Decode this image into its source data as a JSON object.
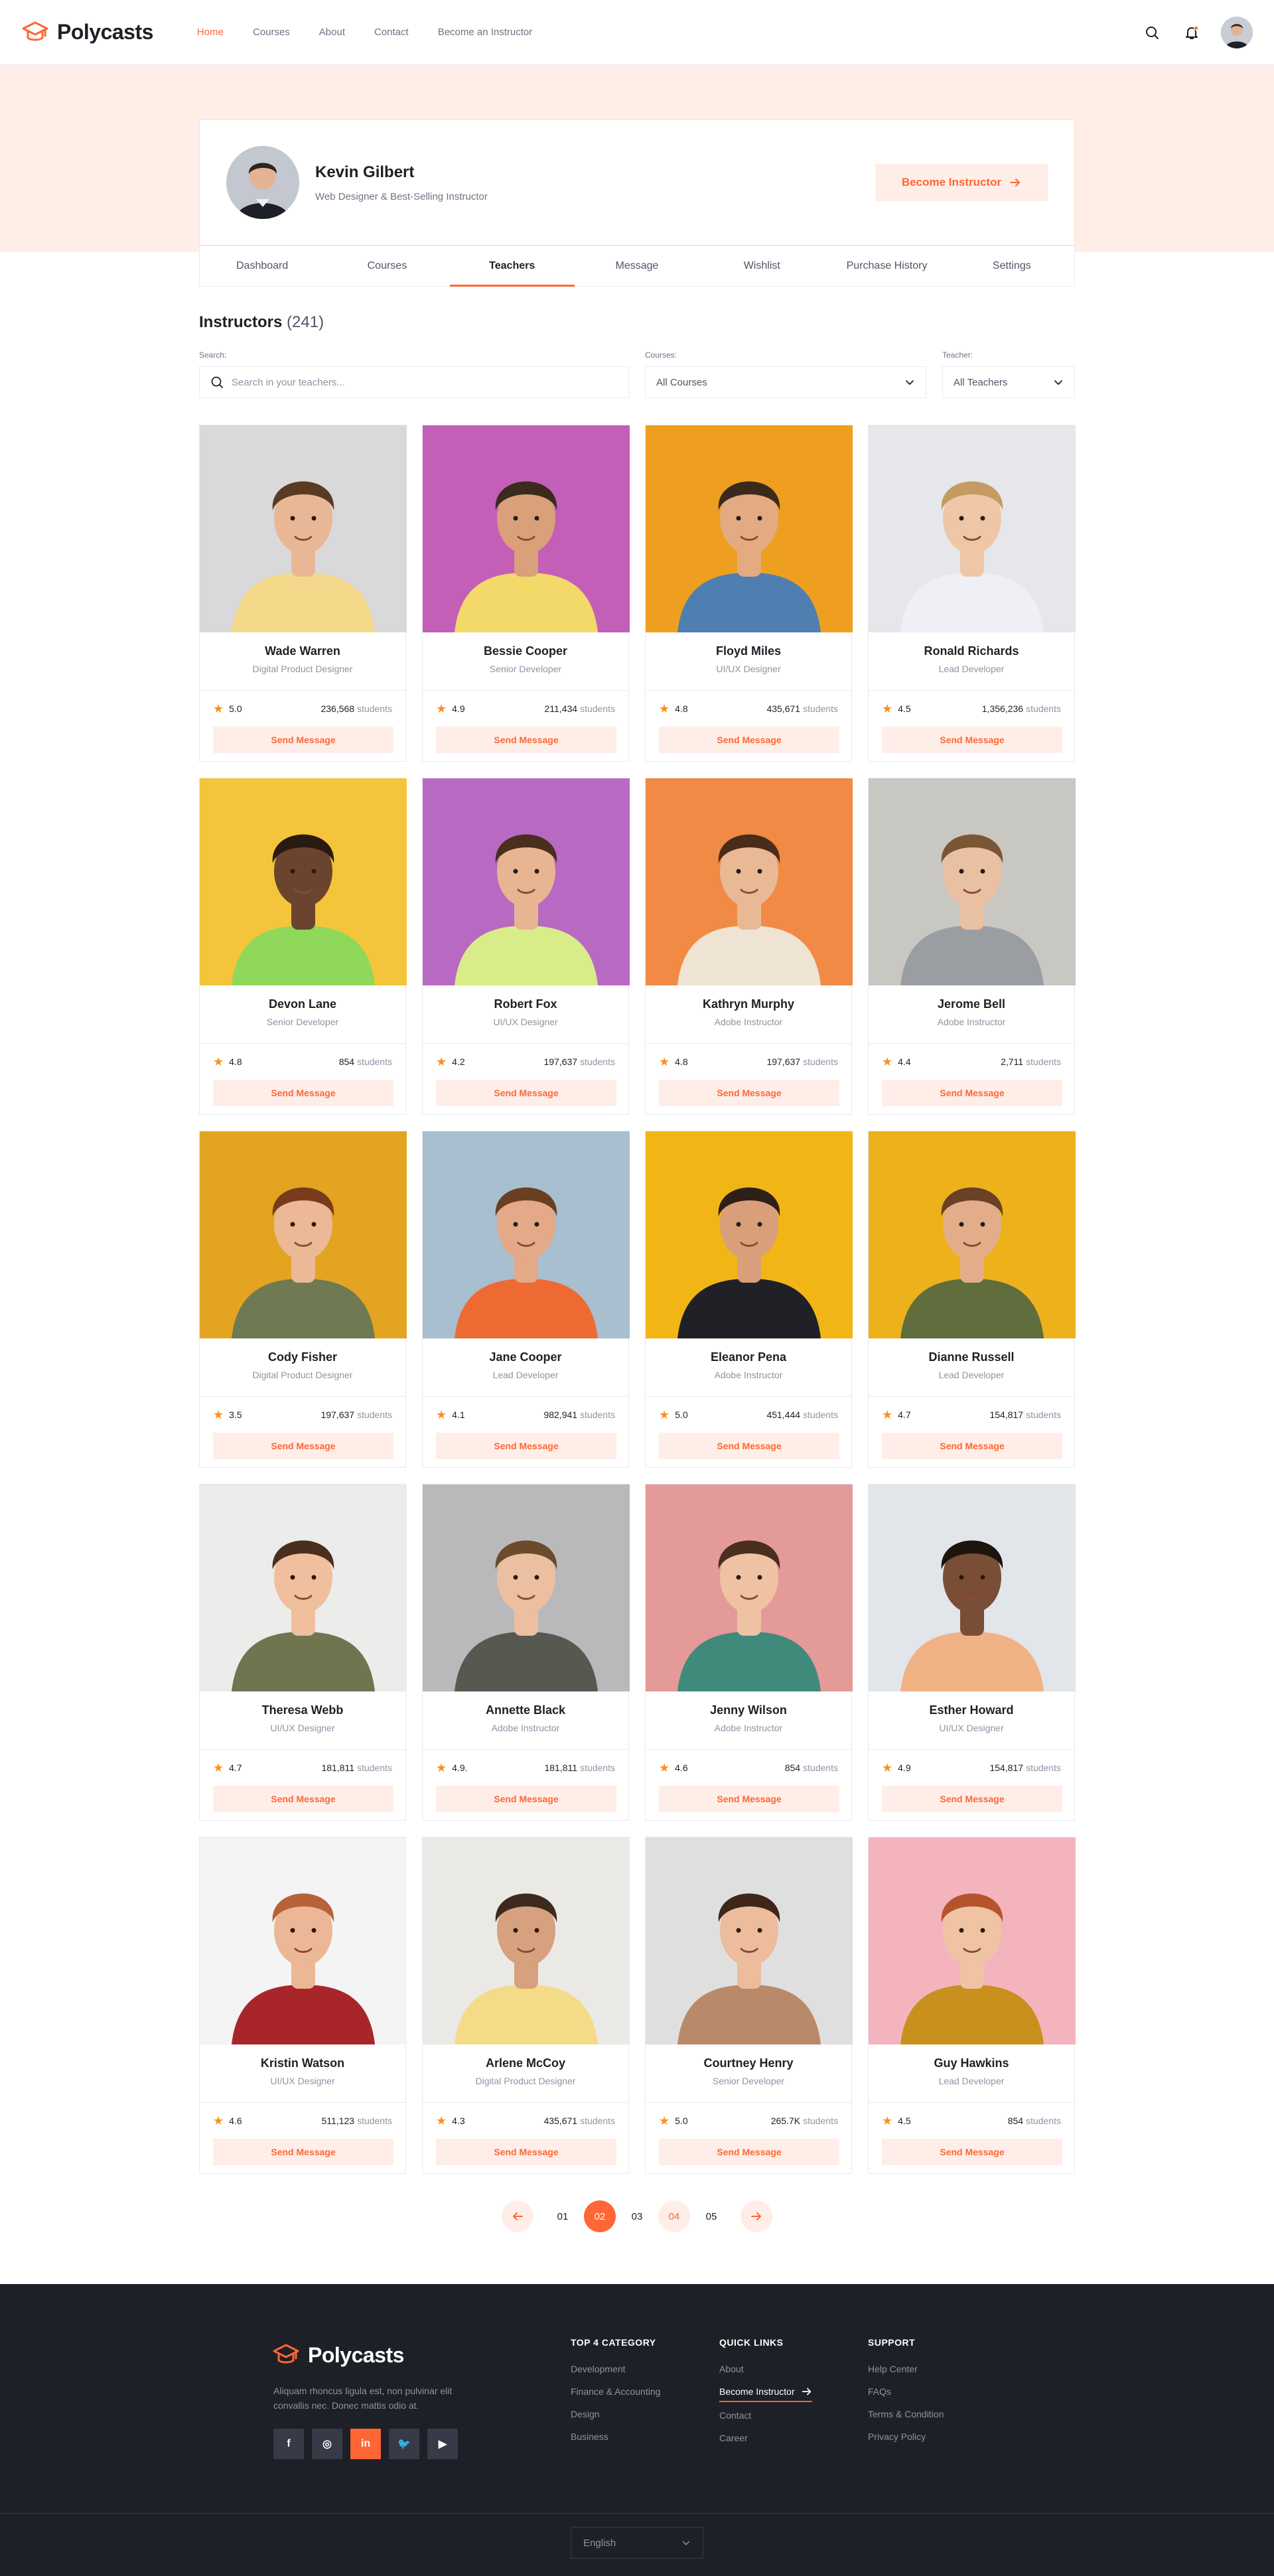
{
  "brand": {
    "name": "Polycasts",
    "accent": "#ff6636",
    "accent_soft": "#ffeee8",
    "dark": "#1d2026"
  },
  "nav": [
    {
      "label": "Home",
      "active": true
    },
    {
      "label": "Courses",
      "active": false
    },
    {
      "label": "About",
      "active": false
    },
    {
      "label": "Contact",
      "active": false
    },
    {
      "label": "Become an Instructor",
      "active": false
    }
  ],
  "header_icons": [
    "search-icon",
    "bell-icon",
    "avatar"
  ],
  "profile": {
    "name": "Kevin Gilbert",
    "role": "Web Designer & Best-Selling Instructor",
    "cta": "Become Instructor"
  },
  "tabs": [
    "Dashboard",
    "Courses",
    "Teachers",
    "Message",
    "Wishlist",
    "Purchase History",
    "Settings"
  ],
  "active_tab": "Teachers",
  "instructors_section": {
    "title": "Instructors",
    "count": "(241)",
    "search_label": "Search:",
    "search_placeholder": "Search in your teachers...",
    "courses_label": "Courses:",
    "courses_value": "All Courses",
    "teacher_label": "Teacher:",
    "teacher_value": "All Teachers"
  },
  "card_button_label": "Send Message",
  "students_suffix": "students",
  "instructors": [
    {
      "name": "Wade Warren",
      "role": "Digital Product Designer",
      "rating": "5.0",
      "students": "236,568",
      "bg": "#d9d9db",
      "shirt": "#f5d98a",
      "skin": "#e8b896",
      "hair": "#5a3a22"
    },
    {
      "name": "Bessie Cooper",
      "role": "Senior Developer",
      "rating": "4.9",
      "students": "211,434",
      "bg": "#c45fb8",
      "shirt": "#f3d86a",
      "skin": "#d9a07a",
      "hair": "#3b2a1e"
    },
    {
      "name": "Floyd Miles",
      "role": "UI/UX Designer",
      "rating": "4.8",
      "students": "435,671",
      "bg": "#ef9f1f",
      "shirt": "#4f7fb0",
      "skin": "#e4aa82",
      "hair": "#3a2a1c"
    },
    {
      "name": "Ronald Richards",
      "role": "Lead Developer",
      "rating": "4.5",
      "students": "1,356,236",
      "bg": "#e6e7ea",
      "shirt": "#eef0f5",
      "skin": "#efc6a6",
      "hair": "#c59a63"
    },
    {
      "name": "Devon Lane",
      "role": "Senior Developer",
      "rating": "4.8",
      "students": "854",
      "bg": "#f4c53a",
      "shirt": "#8fd85a",
      "skin": "#6b4430",
      "hair": "#2a1a12"
    },
    {
      "name": "Robert Fox",
      "role": "UI/UX Designer",
      "rating": "4.2",
      "students": "197,637",
      "bg": "#b86ac2",
      "shirt": "#d9ec8a",
      "skin": "#e7b592",
      "hair": "#4a2e1e"
    },
    {
      "name": "Kathryn Murphy",
      "role": "Adobe Instructor",
      "rating": "4.8",
      "students": "197,637",
      "bg": "#f08a44",
      "shirt": "#efe3d4",
      "skin": "#e9b895",
      "hair": "#4a2c1a"
    },
    {
      "name": "Jerome Bell",
      "role": "Adobe Instructor",
      "rating": "4.4",
      "students": "2,711",
      "bg": "#c9c7c2",
      "shirt": "#9a9ea3",
      "skin": "#eac0a2",
      "hair": "#7a5634"
    },
    {
      "name": "Cody Fisher",
      "role": "Digital Product Designer",
      "rating": "3.5",
      "students": "197,637",
      "bg": "#e2a421",
      "shirt": "#6f7a52",
      "skin": "#ecb996",
      "hair": "#7a3a1c"
    },
    {
      "name": "Jane Cooper",
      "role": "Lead Developer",
      "rating": "4.1",
      "students": "982,941",
      "bg": "#a8bfcf",
      "shirt": "#ee6a33",
      "skin": "#e4a986",
      "hair": "#6a3f22"
    },
    {
      "name": "Eleanor Pena",
      "role": "Adobe Instructor",
      "rating": "5.0",
      "students": "451,444",
      "bg": "#f1b616",
      "shirt": "#1f2126",
      "skin": "#d99f7a",
      "hair": "#2e2018"
    },
    {
      "name": "Dianne Russell",
      "role": "Lead Developer",
      "rating": "4.7",
      "students": "154,817",
      "bg": "#edb11c",
      "shirt": "#5f6e3c",
      "skin": "#e4ad8a",
      "hair": "#6a4124"
    },
    {
      "name": "Theresa Webb",
      "role": "UI/UX Designer",
      "rating": "4.7",
      "students": "181,811",
      "bg": "#ececea",
      "shirt": "#707550",
      "skin": "#efbf9e",
      "hair": "#4a2e1e"
    },
    {
      "name": "Annette Black",
      "role": "Adobe Instructor",
      "rating": "4.9.",
      "students": "181,811",
      "bg": "#b9b9bb",
      "shirt": "#56594f",
      "skin": "#ecbfa0",
      "hair": "#6c4a2c"
    },
    {
      "name": "Jenny Wilson",
      "role": "Adobe Instructor",
      "rating": "4.6",
      "students": "854",
      "bg": "#e39a98",
      "shirt": "#3f8a7a",
      "skin": "#efc2a4",
      "hair": "#4a2e1e"
    },
    {
      "name": "Esther Howard",
      "role": "UI/UX Designer",
      "rating": "4.9",
      "students": "154,817",
      "bg": "#e2e5ea",
      "shirt": "#f1b286",
      "skin": "#7a4d36",
      "hair": "#1e140e"
    },
    {
      "name": "Kristin Watson",
      "role": "UI/UX Designer",
      "rating": "4.6",
      "students": "511,123",
      "bg": "#f4f4f4",
      "shirt": "#a8262a",
      "skin": "#ecb796",
      "hair": "#b8623a"
    },
    {
      "name": "Arlene McCoy",
      "role": "Digital Product Designer",
      "rating": "4.3",
      "students": "435,671",
      "bg": "#ebe9e5",
      "shirt": "#f3db88",
      "skin": "#d7a07e",
      "hair": "#3c2a1e"
    },
    {
      "name": "Courtney Henry",
      "role": "Senior Developer",
      "rating": "5.0",
      "students": "265.7K",
      "bg": "#dfdfe0",
      "shirt": "#b98a6a",
      "skin": "#ecbc9c",
      "hair": "#3e2618"
    },
    {
      "name": "Guy Hawkins",
      "role": "Lead Developer",
      "rating": "4.5",
      "students": "854",
      "bg": "#f4b4be",
      "shirt": "#c9901e",
      "skin": "#f0c3a3",
      "hair": "#b5532c"
    }
  ],
  "pagination": {
    "pages": [
      "01",
      "02",
      "03",
      "04",
      "05"
    ],
    "active": "02",
    "highlighted": "04"
  },
  "footer": {
    "brand": "Polycasts",
    "description": "Aliquam rhoncus ligula est, non pulvinar elit convallis nec. Donec mattis odio at.",
    "socials": [
      {
        "icon": "facebook-icon",
        "glyph": "f"
      },
      {
        "icon": "instagram-icon",
        "glyph": "◎"
      },
      {
        "icon": "linkedin-icon",
        "glyph": "in"
      },
      {
        "icon": "twitter-icon",
        "glyph": "🐦"
      },
      {
        "icon": "youtube-icon",
        "glyph": "▶"
      }
    ],
    "columns": [
      {
        "title": "TOP 4 CATEGORY",
        "links": [
          "Development",
          "Finance & Accounting",
          "Design",
          "Business"
        ]
      },
      {
        "title": "QUICK LINKS",
        "links": [
          "About",
          "Become Instructor",
          "Contact",
          "Career"
        ]
      },
      {
        "title": "SUPPORT",
        "links": [
          "Help Center",
          "FAQs",
          "Terms & Condition",
          "Privacy Policy"
        ]
      }
    ],
    "language": "English"
  }
}
